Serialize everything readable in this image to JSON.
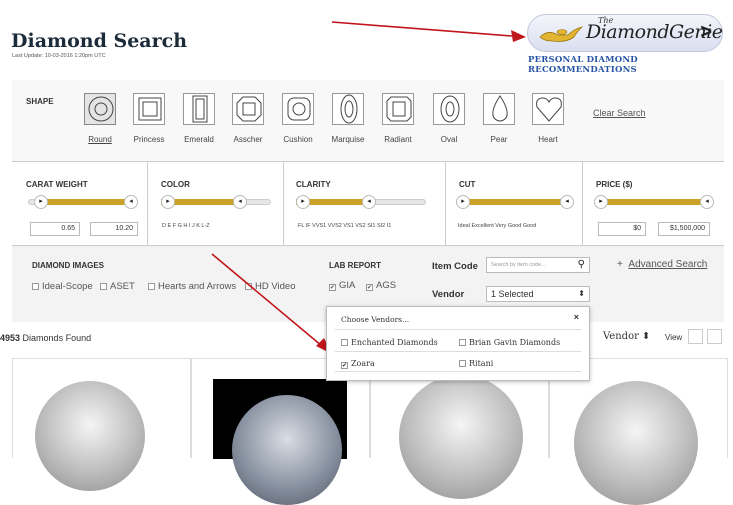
{
  "header": {
    "title": "Diamond Search",
    "last_update": "Last Update: 10-03-2016 1:20pm UTC"
  },
  "genie": {
    "the": "The",
    "name": "DiamondGenie",
    "arrow": ">",
    "tagline": "PERSONAL DIAMOND RECOMMENDATIONS"
  },
  "shape": {
    "label": "SHAPE",
    "clear": "Clear Search",
    "items": [
      {
        "name": "Round",
        "selected": true
      },
      {
        "name": "Princess"
      },
      {
        "name": "Emerald"
      },
      {
        "name": "Asscher"
      },
      {
        "name": "Cushion"
      },
      {
        "name": "Marquise"
      },
      {
        "name": "Radiant"
      },
      {
        "name": "Oval"
      },
      {
        "name": "Pear"
      },
      {
        "name": "Heart"
      }
    ]
  },
  "carat": {
    "label": "CARAT WEIGHT",
    "min": "0.65",
    "max": "10.20"
  },
  "color": {
    "label": "COLOR",
    "ticks": "D    E    F    G    H    I    J    K    L-Z"
  },
  "clarity": {
    "label": "CLARITY",
    "ticks": "FL   IF  VVS1 VVS2  VS1  VS2   SI1   SI2   I1"
  },
  "cut": {
    "label": "CUT",
    "ticks": "Ideal   Excellent   Very Good   Good"
  },
  "price": {
    "label": "PRICE ($)",
    "min": "$0",
    "max": "$1,500,000"
  },
  "images": {
    "label": "DIAMOND IMAGES",
    "options": [
      "Ideal-Scope",
      "ASET",
      "Hearts and Arrows",
      "HD Video"
    ]
  },
  "lab": {
    "label": "LAB REPORT",
    "options": [
      "GIA",
      "AGS"
    ]
  },
  "item_code": {
    "label": "Item Code",
    "placeholder": "Search by item code..."
  },
  "vendor": {
    "label": "Vendor",
    "value": "1 Selected"
  },
  "advanced": {
    "plus": "+",
    "label": "Advanced Search"
  },
  "results": {
    "count": "4953",
    "suffix": "Diamonds Found",
    "sort": "Vendor",
    "view": "View"
  },
  "dropdown": {
    "title": "Choose Vendors...",
    "close": "×",
    "vendors": [
      {
        "name": "Enchanted Diamonds",
        "checked": false
      },
      {
        "name": "Brian Gavin Diamonds",
        "checked": false
      },
      {
        "name": "Zoara",
        "checked": true
      },
      {
        "name": "Ritani",
        "checked": false
      }
    ]
  },
  "colors": {
    "accent": "#c9a227",
    "arrow": "#c0151b",
    "link": "#2855a6"
  }
}
